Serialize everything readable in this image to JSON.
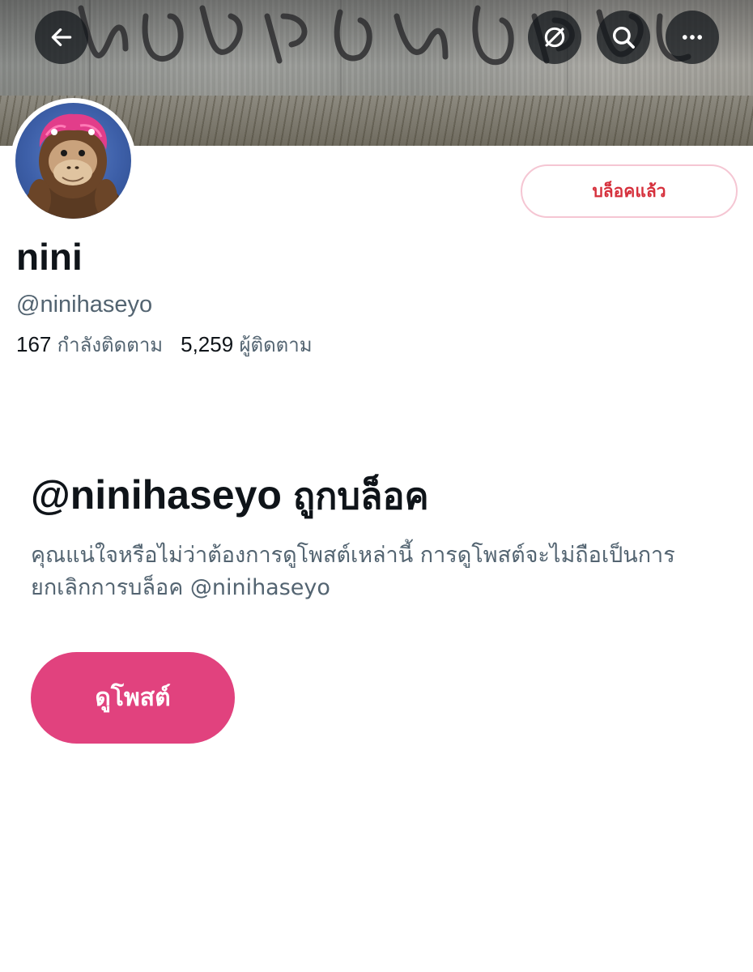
{
  "header": {
    "back_icon": "arrow-left-icon",
    "grok_icon": "slashed-circle-icon",
    "search_icon": "search-icon",
    "more_icon": "more-horizontal-icon",
    "banner_description": ""
  },
  "profile": {
    "display_name": "nini",
    "handle": "@ninihaseyo",
    "following_count": "167",
    "following_label": "กำลังติดตาม",
    "followers_count": "5,259",
    "followers_label": "ผู้ติดตาม",
    "blocked_button_label": "บล็อคแล้ว"
  },
  "blocked_notice": {
    "handle": "@ninihaseyo",
    "title_suffix": "ถูกบล็อค",
    "description": "คุณแน่ใจหรือไม่ว่าต้องการดูโพสต์เหล่านี้ การดูโพสต์จะไม่ถือเป็นการยกเลิกการบล็อค @ninihaseyo",
    "view_posts_label": "ดูโพสต์"
  },
  "colors": {
    "accent_pink": "#e1427e",
    "blocked_red": "#d6313d",
    "blocked_border": "#f5c6d3",
    "secondary_text": "#536471",
    "primary_text": "#0f1419"
  }
}
